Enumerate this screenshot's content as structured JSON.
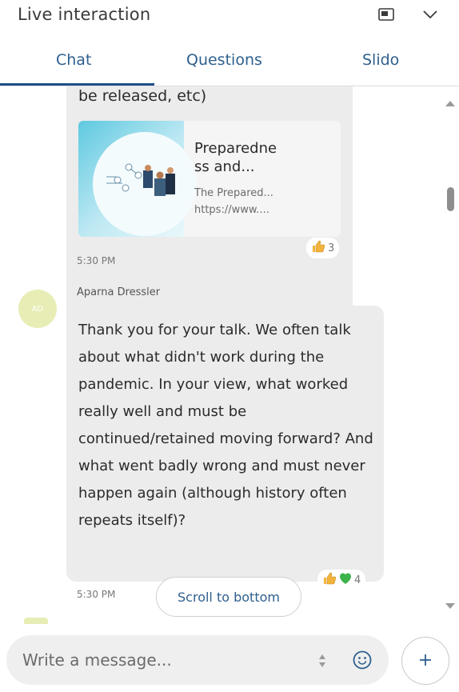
{
  "header": {
    "title": "Live interaction",
    "popout_icon": "popout-icon",
    "collapse_icon": "chevron-down-icon"
  },
  "tabs": [
    {
      "label": "Chat",
      "active": true
    },
    {
      "label": "Questions",
      "active": false
    },
    {
      "label": "Slido",
      "active": false
    }
  ],
  "messages": [
    {
      "text_tail": "be released, etc)",
      "link": {
        "title": "Preparedne ss and...",
        "title_line1": "Preparedne",
        "title_line2": "ss and...",
        "description": "The Prepared...",
        "url": "https://www...."
      },
      "reactions": {
        "icons": [
          "thumbs-up-icon"
        ],
        "count": "3"
      },
      "time": "5:30 PM"
    },
    {
      "author": "Aparna Dressler",
      "avatar_initials": "AD",
      "text": "Thank you for your talk. We often talk about what didn't work during the pandemic. In your view, what worked really well and must be continued/retained moving forward? And what went badly wrong and must never happen again (although history often repeats itself)?",
      "reactions": {
        "icons": [
          "thumbs-up-icon",
          "green-heart-icon"
        ],
        "count": "4"
      },
      "time": "5:30 PM"
    }
  ],
  "scroll_to_bottom_label": "Scroll to bottom",
  "composer": {
    "placeholder": "Write a message...",
    "emoji_icon": "smiley-icon",
    "add_icon": "plus-icon"
  },
  "colors": {
    "accent": "#1f4f86",
    "tab_text": "#2e5f8e",
    "bubble_bg": "#ececec",
    "avatar_bg": "#e8edb5",
    "heart": "#3cb44b",
    "thumb": "#f2b33d"
  }
}
